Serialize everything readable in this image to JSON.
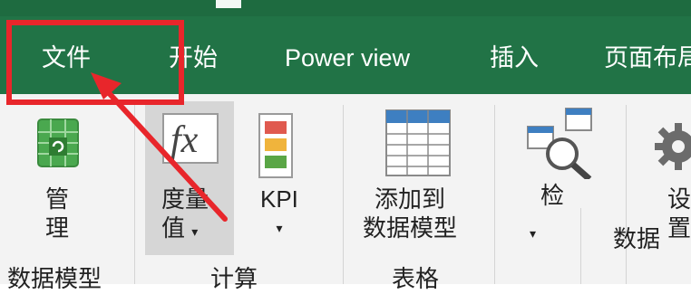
{
  "tabs": {
    "file": "文件",
    "home": "开始",
    "power_view": "Power view",
    "insert": "插入",
    "page_layout": "页面布局"
  },
  "ribbon": {
    "manage": {
      "line1": "管",
      "line2": "理"
    },
    "measures": {
      "line1": "度量",
      "line2": "值",
      "caret": "▾"
    },
    "kpi": {
      "label": "KPI",
      "caret": "▾"
    },
    "add_to_model": {
      "line1": "添加到",
      "line2": "数据模型"
    },
    "detect": {
      "label": "检",
      "caret": "▾"
    },
    "data": {
      "label": "数据"
    },
    "settings": {
      "line1": "设",
      "line2": "置"
    }
  },
  "groups": {
    "data_model": "数据模型",
    "calculations": "计算",
    "tables": "表格"
  },
  "colors": {
    "tab_bar": "#217346",
    "highlight_box": "#e8262b",
    "ribbon_bg": "#f3f3f3"
  },
  "icons": [
    "manage-grid-icon",
    "fx-icon",
    "kpi-icon",
    "table-icon",
    "detect-relationships-icon",
    "gear-icon"
  ]
}
